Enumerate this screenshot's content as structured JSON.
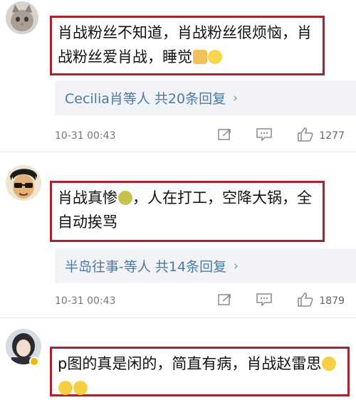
{
  "comments": [
    {
      "text": "肖战粉丝不知道，肖战粉丝很烦恼，肖战粉丝爱肖战，睡觉",
      "emojis": [
        "pray-hands-emoji",
        "grin-emoji"
      ],
      "reply_summary": "Cecilia肖等人  共20条回复",
      "time": "10-31 00:43",
      "likes": "1277"
    },
    {
      "text": "肖战真惨",
      "text_after": "，人在打工，空降大锅，全自动挨骂",
      "emojis": [
        "crying-emoji"
      ],
      "reply_summary": "半岛往事-等人  共14条回复",
      "time": "10-31 00:43",
      "likes": "1879"
    },
    {
      "text": "p图的真是闲的，简直有病，肖战赵雷思",
      "emojis": [
        "sweat-emoji",
        "sweat-emoji",
        "sweat-emoji"
      ]
    }
  ],
  "icons": {
    "reply_chevron": "›",
    "share": "share-icon",
    "comment": "comment-icon",
    "like": "thumb-up-icon"
  },
  "colors": {
    "highlight_border": "#a3242a",
    "link": "#4d7aa3",
    "reply_bg": "#f1f3f6"
  }
}
